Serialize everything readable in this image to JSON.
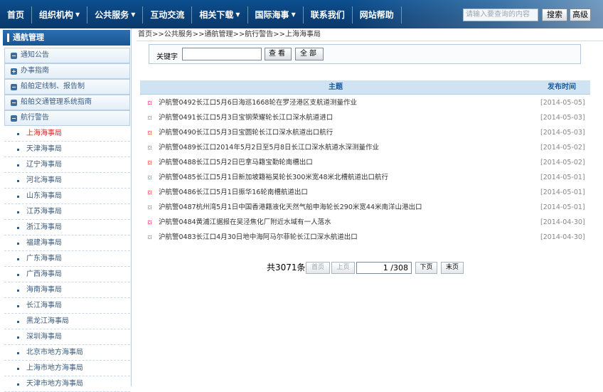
{
  "nav": {
    "items": [
      {
        "label": "首页",
        "caret": ""
      },
      {
        "label": "组织机构",
        "caret": "▼"
      },
      {
        "label": "公共服务",
        "caret": "▼"
      },
      {
        "label": "互动交流",
        "caret": ""
      },
      {
        "label": "相关下载",
        "caret": "▼"
      },
      {
        "label": "国际海事",
        "caret": "▼"
      },
      {
        "label": "联系我们",
        "caret": ""
      },
      {
        "label": "网站帮助",
        "caret": ""
      }
    ],
    "search_placeholder": "请输入要查询的内容",
    "search_label": "搜索",
    "advanced_label": "高级"
  },
  "sidebar": {
    "title": "通航管理",
    "categories": [
      {
        "label": "通知公告",
        "sym": "−"
      },
      {
        "label": "办事指南",
        "sym": "+"
      },
      {
        "label": "船舶定线制、报告制",
        "sym": "−"
      },
      {
        "label": "船舶交通管理系统指南",
        "sym": "−"
      },
      {
        "label": "航行警告",
        "sym": "−"
      }
    ],
    "subitems": [
      "上海海事局",
      "天津海事局",
      "辽宁海事局",
      "河北海事局",
      "山东海事局",
      "江苏海事局",
      "浙江海事局",
      "福建海事局",
      "广东海事局",
      "广西海事局",
      "海南海事局",
      "长江海事局",
      "黑龙江海事局",
      "深圳海事局",
      "北京市地方海事局",
      "上海市地方海事局",
      "天津市地方海事局"
    ]
  },
  "breadcrumb": "首页>>公共服务>>通航管理>>航行警告>>上海海事局",
  "keyword": {
    "label": "关键字",
    "value": "",
    "search_btn": "查看",
    "all_btn": "全部"
  },
  "table": {
    "headers": {
      "subject": "主题",
      "date": "发布时间"
    },
    "rows": [
      {
        "title": "沪航警0492长江口5月6日海巡1668轮在罗泾港区支航道测量作业",
        "date": "[2014-05-05]"
      },
      {
        "title": "沪航警0491长江口5月3日宝钢荣耀轮长江口深水航道进口",
        "date": "[2014-05-03]"
      },
      {
        "title": "沪航警0490长江口5月3日宝圆轮长江口深水航道出口航行",
        "date": "[2014-05-03]"
      },
      {
        "title": "沪航警0489长江口2014年5月2日至5月8日长江口深水航道水深测量作业",
        "date": "[2014-05-02]"
      },
      {
        "title": "沪航警0488长江口5月2日巴拿马籍宝勤轮南槽出口",
        "date": "[2014-05-02]"
      },
      {
        "title": "沪航警0485长江口5月1日新加坡籍裕昊轮长300米宽48米北槽航道出口航行",
        "date": "[2014-05-01]"
      },
      {
        "title": "沪航警0486长江口5月1日振华16轮南槽航道出口",
        "date": "[2014-05-01]"
      },
      {
        "title": "沪航警0487杭州湾5月1日中国香港籍液化天然气船申海轮长290米宽44米南洋山港出口",
        "date": "[2014-05-01]"
      },
      {
        "title": "沪航警0484黄浦江据报在吴泾焦化厂附近水域有一人落水",
        "date": "[2014-04-30]"
      },
      {
        "title": "沪航警0483长江口4月30日地中海阿马尔菲轮长江口深水航道出口",
        "date": "[2014-04-30]"
      }
    ]
  },
  "pager": {
    "total": "共3071条",
    "first": "首页",
    "prev": "上页",
    "page": "1 /308",
    "next": "下页",
    "last": "末页"
  },
  "colors": {
    "nav_bg": "#0c4f8f",
    "sidebar_head": "#195593",
    "table_head": "#cfe3f3",
    "active": "#dd2222"
  }
}
